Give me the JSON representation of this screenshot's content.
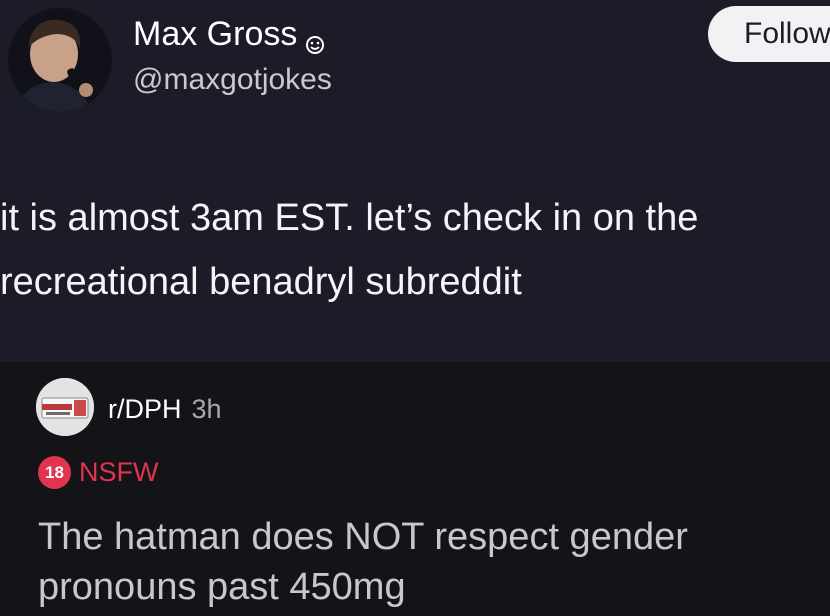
{
  "author": {
    "display_name": "Max Gross",
    "handle": "@maxgotjokes",
    "avatar_icon": "person-with-microphone",
    "badge_icon": "smiley-emoji-icon"
  },
  "follow_button": {
    "label": "Follow"
  },
  "tweet": {
    "lines": [
      "it is almost 3am EST. let’s check in on the",
      "recreational benadryl subreddit"
    ]
  },
  "embed": {
    "subreddit": "r/DPH",
    "time": "3h",
    "subreddit_icon": "pill-box-icon",
    "age_badge": "18",
    "nsfw_label": "NSFW",
    "title_lines": [
      "The hatman does NOT respect gender",
      "pronouns past 450mg"
    ]
  },
  "colors": {
    "background": "#1b1c27",
    "embed_background": "#141318",
    "nsfw_red": "#e0344f",
    "button": "#f2f2f4"
  }
}
